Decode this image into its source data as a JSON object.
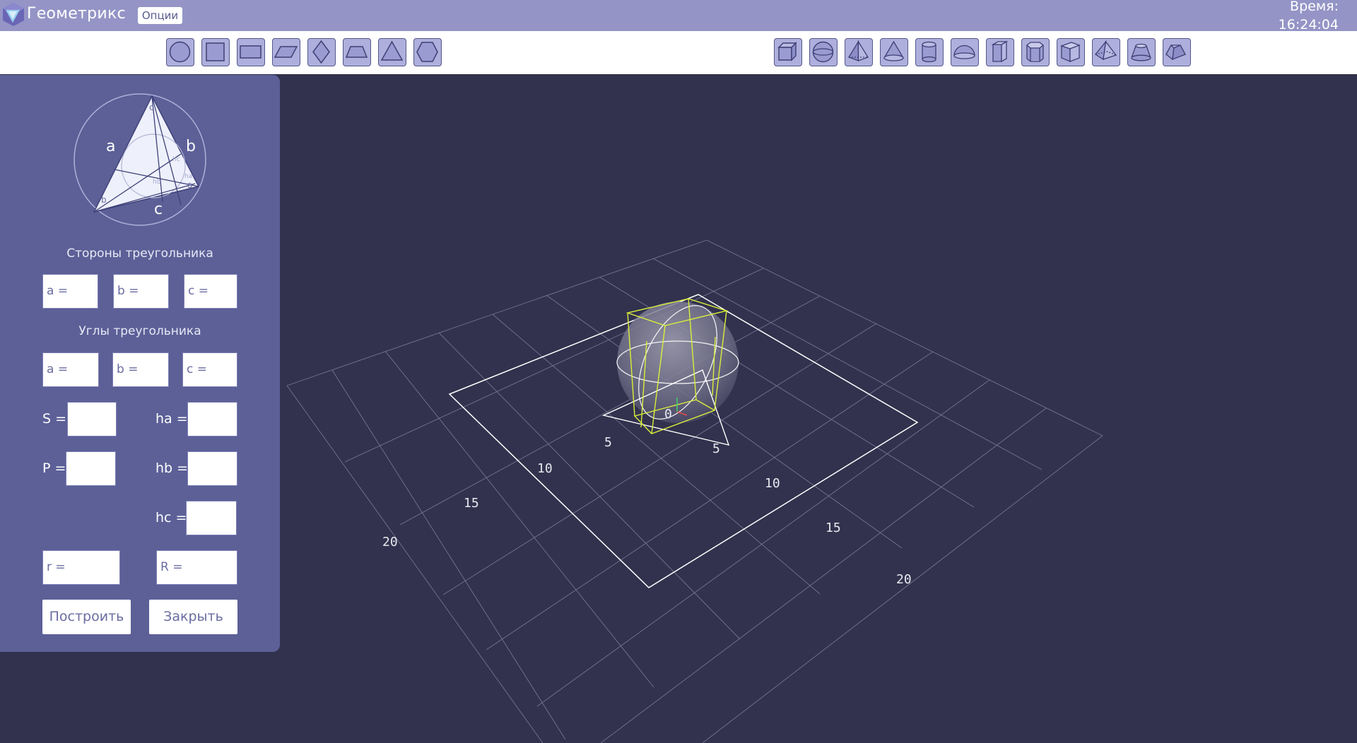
{
  "app": {
    "title": "Геометрикс",
    "options_label": "Опции",
    "time_label": "Время:",
    "time_value": "16:24:04"
  },
  "toolbar": {
    "shapes_2d": [
      "circle-icon",
      "square-icon",
      "rectangle-icon",
      "parallelogram-icon",
      "rhombus-icon",
      "trapezoid-icon",
      "triangle-icon",
      "hexagon-icon"
    ],
    "shapes_3d": [
      "cube-icon",
      "sphere-icon",
      "pyramid-icon",
      "cone-icon",
      "cylinder-icon",
      "hemisphere-icon",
      "prism-icon",
      "hexagonal-prism-icon",
      "triangular-prism-icon",
      "square-pyramid-icon",
      "frustum-icon",
      "truncated-pyramid-icon"
    ]
  },
  "panel": {
    "diagram": {
      "side_a": "a",
      "side_b": "b",
      "side_c": "c",
      "angle_a": "a",
      "angle_b": "b",
      "angle_c": "c",
      "h_a": "ha",
      "h_b": "hb",
      "h_c": "hc"
    },
    "sides_title": "Стороны треугольника",
    "sides": {
      "a": "a =",
      "b": "b =",
      "c": "c ="
    },
    "angles_title": "Углы треугольника",
    "angles": {
      "a": "a =",
      "b": "b =",
      "c": "c ="
    },
    "area_label": "S =",
    "perimeter_label": "P =",
    "ha_label": "ha =",
    "hb_label": "hb =",
    "hc_label": "hc =",
    "r_placeholder": "r =",
    "R_placeholder": "R =",
    "build_label": "Построить",
    "close_label": "Закрыть"
  },
  "viewport": {
    "axis_labels_x": [
      "5",
      "10",
      "15",
      "20"
    ],
    "axis_labels_z": [
      "5",
      "10",
      "15",
      "20"
    ],
    "origin_label": "0",
    "colors": {
      "background": "#32324e",
      "grid": "#8a8aa6",
      "shape_outline": "#ffffff",
      "cube_outline": "#d9ef3a"
    }
  }
}
